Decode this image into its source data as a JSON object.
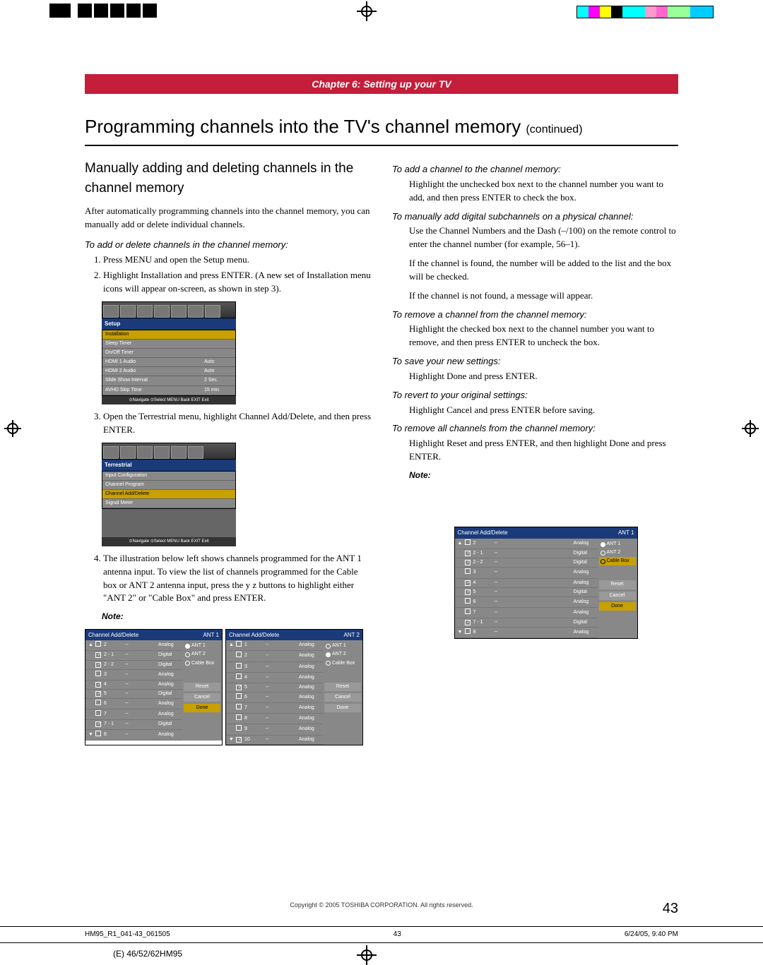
{
  "chapter": "Chapter 6: Setting up your TV",
  "title_main": "Programming channels into the TV's channel memory",
  "title_cont": "(continued)",
  "left": {
    "heading": "Manually adding and deleting channels in the channel memory",
    "intro": "After automatically programming channels into the channel memory, you can manually add or delete individual channels.",
    "sub1": "To add or delete channels in the channel memory:",
    "step1": "Press MENU and open the Setup menu.",
    "step2": "Highlight Installation and press ENTER. (A new set of Installation menu icons will appear on-screen, as shown in step 3).",
    "step3": "Open the Terrestrial menu, highlight Channel Add/Delete, and then press ENTER.",
    "step4": "The illustration below left shows channels programmed for the ANT 1 antenna input. To view the list of channels programmed for the Cable box or ANT 2 antenna input, press the y z buttons to highlight either \"ANT 2\" or \"Cable Box\" and press ENTER.",
    "note": "Note:",
    "setup_menu": {
      "title": "Setup",
      "items": [
        {
          "l": "Installation",
          "r": "",
          "hl": true
        },
        {
          "l": "Sleep Timer",
          "r": ""
        },
        {
          "l": "On/Off Timer",
          "r": ""
        },
        {
          "l": "HDMI 1 Audio",
          "r": "Auto"
        },
        {
          "l": "HDMI 2 Audio",
          "r": "Auto"
        },
        {
          "l": "Slide Show Interval",
          "r": "2 Sec."
        },
        {
          "l": "AVHD Skip Time",
          "r": "15 min"
        }
      ],
      "footer": "⊙Navigate  ⊙Select  MENU Back  EXIT Exit"
    },
    "terr_menu": {
      "title": "Terrestrial",
      "items": [
        {
          "l": "Input Configuration"
        },
        {
          "l": "Channel Program"
        },
        {
          "l": "Channel Add/Delete",
          "hl": true
        },
        {
          "l": "Signal Meter"
        }
      ],
      "footer": "⊙Navigate  ⊙Select  MENU Back  EXIT Exit"
    }
  },
  "right": {
    "sub_add": "To add a channel to the channel memory:",
    "add_txt": "Highlight the unchecked box next to the channel number you want to add, and then press ENTER to check the box.",
    "sub_digital": "To manually add digital subchannels on a physical channel:",
    "dig1": "Use the Channel Numbers and the Dash (–/100) on the remote control to enter the channel number (for example, 56–1).",
    "dig2": "If the channel is found, the number will be added to the list and the box will be checked.",
    "dig3": "If the channel is not found, a message will appear.",
    "sub_remove": "To remove a channel from the channel memory:",
    "rem_txt": "Highlight the checked box next to the channel number you want to remove, and then press ENTER to uncheck the box.",
    "sub_save": "To save your new settings:",
    "save_txt": "Highlight Done and press ENTER.",
    "sub_revert": "To revert to your original settings:",
    "rev_txt": "Highlight Cancel and press ENTER before saving.",
    "sub_removeall": "To remove all channels from the channel memory:",
    "remall_txt": "Highlight Reset and press ENTER, and then highlight Done and press ENTER.",
    "note": "Note:"
  },
  "chart_data": [
    {
      "type": "table",
      "title": "Channel Add/Delete",
      "antenna": "ANT 1",
      "rows": [
        {
          "cb": false,
          "ch": "2",
          "name": "--",
          "type": "Analog",
          "arrow": "▲"
        },
        {
          "cb": true,
          "ch": "2 - 1",
          "name": "--",
          "type": "Digital"
        },
        {
          "cb": true,
          "ch": "2 - 2",
          "name": "--",
          "type": "Digital"
        },
        {
          "cb": false,
          "ch": "3",
          "name": "--",
          "type": "Analog"
        },
        {
          "cb": true,
          "ch": "4",
          "name": "--",
          "type": "Analog"
        },
        {
          "cb": true,
          "ch": "5",
          "name": "--",
          "type": "Digital"
        },
        {
          "cb": false,
          "ch": "6",
          "name": "--",
          "type": "Analog"
        },
        {
          "cb": false,
          "ch": "7",
          "name": "--",
          "type": "Analog"
        },
        {
          "cb": true,
          "ch": "7 - 1",
          "name": "--",
          "type": "Digital"
        },
        {
          "cb": false,
          "ch": "8",
          "name": "--",
          "type": "Analog",
          "arrow": "▼"
        }
      ],
      "radios": [
        {
          "label": "ANT 1",
          "sel": true
        },
        {
          "label": "ANT 2"
        },
        {
          "label": "Cable Box"
        }
      ],
      "buttons": [
        {
          "label": "Reset"
        },
        {
          "label": "Cancel"
        },
        {
          "label": "Done",
          "sel": true
        }
      ]
    },
    {
      "type": "table",
      "title": "Channel Add/Delete",
      "antenna": "ANT 2",
      "rows": [
        {
          "cb": false,
          "ch": "1",
          "name": "--",
          "type": "Analog",
          "arrow": "▲"
        },
        {
          "cb": false,
          "ch": "2",
          "name": "--",
          "type": "Analog"
        },
        {
          "cb": false,
          "ch": "3",
          "name": "--",
          "type": "Analog"
        },
        {
          "cb": false,
          "ch": "4",
          "name": "--",
          "type": "Analog"
        },
        {
          "cb": true,
          "ch": "5",
          "name": "--",
          "type": "Analog"
        },
        {
          "cb": false,
          "ch": "6",
          "name": "--",
          "type": "Analog"
        },
        {
          "cb": false,
          "ch": "7",
          "name": "--",
          "type": "Analog"
        },
        {
          "cb": false,
          "ch": "8",
          "name": "--",
          "type": "Analog"
        },
        {
          "cb": false,
          "ch": "9",
          "name": "--",
          "type": "Analog"
        },
        {
          "cb": true,
          "ch": "10",
          "name": "--",
          "type": "Analog",
          "arrow": "▼"
        }
      ],
      "radios": [
        {
          "label": "ANT 1"
        },
        {
          "label": "ANT 2",
          "sel": true
        },
        {
          "label": "Cable Box"
        }
      ],
      "buttons": [
        {
          "label": "Reset"
        },
        {
          "label": "Cancel"
        },
        {
          "label": "Done"
        }
      ]
    },
    {
      "type": "table",
      "title": "Channel Add/Delete",
      "antenna": "ANT 1",
      "placement": "right-column",
      "rows": [
        {
          "cb": false,
          "ch": "2",
          "name": "--",
          "type": "Analog",
          "arrow": "▲"
        },
        {
          "cb": true,
          "ch": "2 - 1",
          "name": "--",
          "type": "Digital"
        },
        {
          "cb": true,
          "ch": "2 - 2",
          "name": "--",
          "type": "Digital"
        },
        {
          "cb": false,
          "ch": "3",
          "name": "--",
          "type": "Analog"
        },
        {
          "cb": true,
          "ch": "4",
          "name": "--",
          "type": "Analog"
        },
        {
          "cb": true,
          "ch": "5",
          "name": "--",
          "type": "Digital"
        },
        {
          "cb": false,
          "ch": "6",
          "name": "--",
          "type": "Analog"
        },
        {
          "cb": false,
          "ch": "7",
          "name": "--",
          "type": "Analog"
        },
        {
          "cb": true,
          "ch": "7 - 1",
          "name": "--",
          "type": "Digital"
        },
        {
          "cb": false,
          "ch": "8",
          "name": "--",
          "type": "Analog",
          "arrow": "▼"
        }
      ],
      "radios": [
        {
          "label": "ANT 1",
          "sel": true
        },
        {
          "label": "ANT 2"
        },
        {
          "label": "Cable Box",
          "high": true
        }
      ],
      "buttons": [
        {
          "label": "Reset"
        },
        {
          "label": "Cancel"
        },
        {
          "label": "Done",
          "sel": true
        }
      ]
    }
  ],
  "copyright": "Copyright © 2005 TOSHIBA CORPORATION. All rights reserved.",
  "pagenum": "43",
  "print_left": "HM95_R1_041-43_061505",
  "print_mid": "43",
  "print_right": "6/24/05, 9:40 PM",
  "model": "(E) 46/52/62HM95"
}
